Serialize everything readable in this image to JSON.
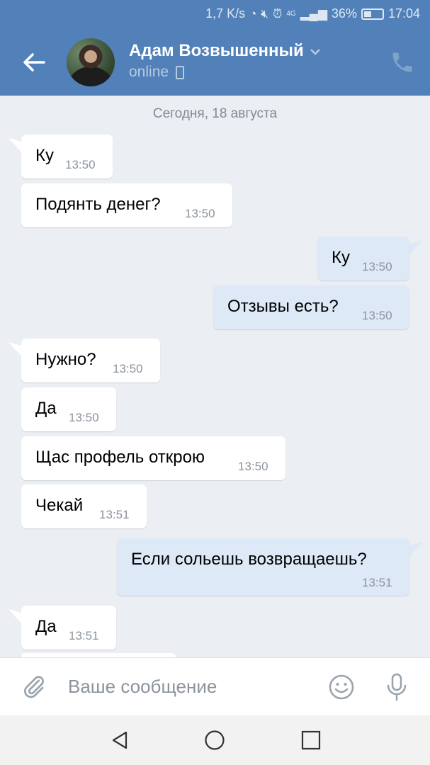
{
  "status_bar": {
    "speed": "1,7 K/s",
    "network": "4G",
    "battery": "36%",
    "time": "17:04"
  },
  "header": {
    "contact_name": "Адам Возвышенный",
    "status": "online"
  },
  "chat": {
    "date_separator": "Сегодня, 18 августа",
    "messages": [
      {
        "direction": "in",
        "text": "Ку",
        "time": "13:50"
      },
      {
        "direction": "in",
        "text": "Подянть денег?",
        "time": "13:50"
      },
      {
        "direction": "out",
        "text": "Ку",
        "time": "13:50"
      },
      {
        "direction": "out",
        "text": "Отзывы есть?",
        "time": "13:50"
      },
      {
        "direction": "in",
        "text": "Нужно?",
        "time": "13:50"
      },
      {
        "direction": "in",
        "text": "Да",
        "time": "13:50"
      },
      {
        "direction": "in",
        "text": "Щас профель открою",
        "time": "13:50"
      },
      {
        "direction": "in",
        "text": "Чекай",
        "time": "13:51"
      },
      {
        "direction": "out",
        "text": "Если сольешь возвращаешь?",
        "time": "13:51"
      },
      {
        "direction": "in",
        "text": "Да",
        "time": "13:51"
      }
    ]
  },
  "composer": {
    "placeholder": "Ваше сообщение"
  },
  "colors": {
    "header": "#5181b8",
    "background": "#ebeef2",
    "incoming_bubble": "#ffffff",
    "outgoing_bubble": "#dde9f7"
  },
  "icons": [
    "back-arrow-icon",
    "chevron-down-icon",
    "mobile-phone-icon",
    "phone-call-icon",
    "paperclip-icon",
    "smile-icon",
    "microphone-icon",
    "nav-back-icon",
    "nav-home-icon",
    "nav-recents-icon"
  ]
}
